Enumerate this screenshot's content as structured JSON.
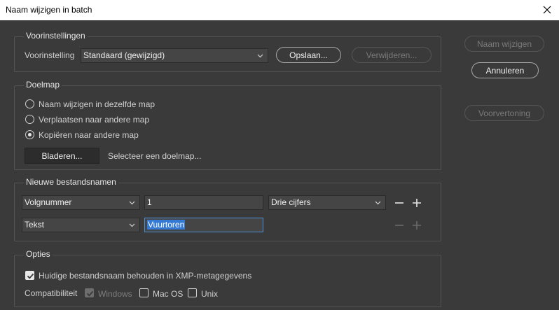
{
  "window": {
    "title": "Naam wijzigen in batch",
    "close_icon": "close-icon"
  },
  "presets": {
    "group_title": "Voorinstellingen",
    "label": "Voorinstelling",
    "selected": "Standaard (gewijzigd)",
    "save_label": "Opslaan...",
    "delete_label": "Verwijderen..."
  },
  "destination": {
    "group_title": "Doelmap",
    "options": [
      {
        "label": "Naam wijzigen in dezelfde map",
        "checked": false
      },
      {
        "label": "Verplaatsen naar andere map",
        "checked": false
      },
      {
        "label": "Kopiëren naar andere map",
        "checked": true
      }
    ],
    "browse_label": "Bladeren...",
    "path_placeholder": "Selecteer een doelmap..."
  },
  "filenames": {
    "group_title": "Nieuwe bestandsnamen",
    "rows": [
      {
        "type": "Volgnummer",
        "value": "1",
        "format": "Drie cijfers",
        "buttons_enabled": true
      },
      {
        "type": "Tekst",
        "value": "Vuurtoren",
        "buttons_enabled": false
      }
    ]
  },
  "options": {
    "group_title": "Opties",
    "keep_xmp_label": "Huidige bestandsnaam behouden in XMP-metagegevens",
    "keep_xmp_checked": true,
    "compat_label": "Compatibiliteit",
    "compat": [
      {
        "label": "Windows",
        "checked": true,
        "disabled": true
      },
      {
        "label": "Mac OS",
        "checked": false,
        "disabled": false
      },
      {
        "label": "Unix",
        "checked": false,
        "disabled": false
      }
    ]
  },
  "actions": {
    "rename_label": "Naam wijzigen",
    "cancel_label": "Annuleren",
    "preview_label": "Voorvertoning"
  },
  "colors": {
    "background": "#3a3a3a",
    "accent": "#3479d3",
    "focus": "#4a8fd6"
  }
}
